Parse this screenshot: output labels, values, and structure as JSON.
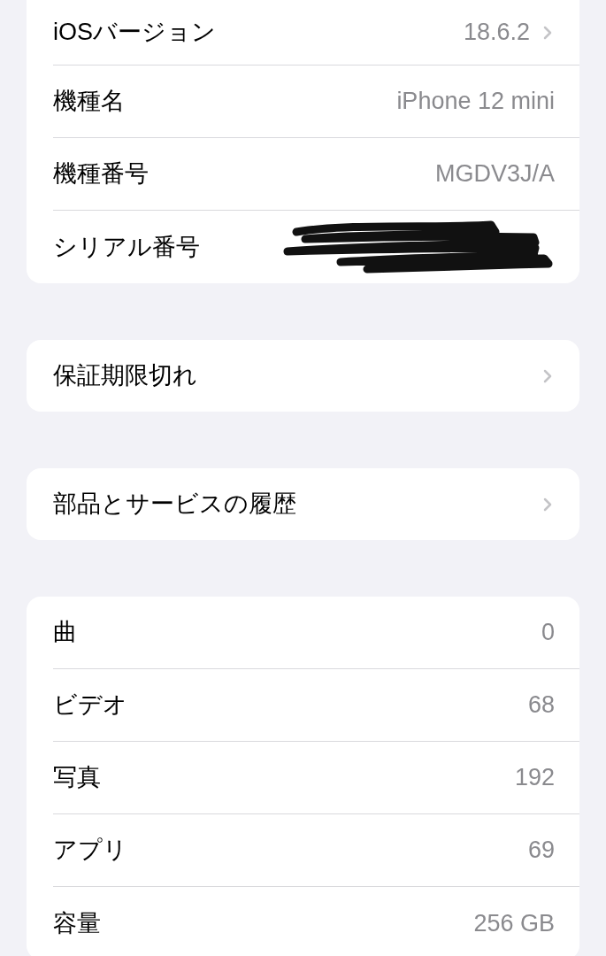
{
  "groups": [
    {
      "rows": [
        {
          "label": "iOSバージョン",
          "kind": "value",
          "value": "18.6.2",
          "chevron": true
        },
        {
          "label": "機種名",
          "kind": "value",
          "value": "iPhone 12 mini",
          "chevron": false
        },
        {
          "label": "機種番号",
          "kind": "value",
          "value": "MGDV3J/A",
          "chevron": false
        },
        {
          "label": "シリアル番号",
          "kind": "redacted",
          "chevron": false
        }
      ]
    },
    {
      "rows": [
        {
          "label": "保証期限切れ",
          "kind": "link",
          "chevron": true
        }
      ]
    },
    {
      "rows": [
        {
          "label": "部品とサービスの履歴",
          "kind": "link",
          "chevron": true
        }
      ]
    },
    {
      "rows": [
        {
          "label": "曲",
          "kind": "value",
          "value": "0",
          "chevron": false
        },
        {
          "label": "ビデオ",
          "kind": "value",
          "value": "68",
          "chevron": false
        },
        {
          "label": "写真",
          "kind": "value",
          "value": "192",
          "chevron": false
        },
        {
          "label": "アプリ",
          "kind": "value",
          "value": "69",
          "chevron": false
        },
        {
          "label": "容量",
          "kind": "value",
          "value": "256 GB",
          "chevron": false
        }
      ]
    }
  ]
}
